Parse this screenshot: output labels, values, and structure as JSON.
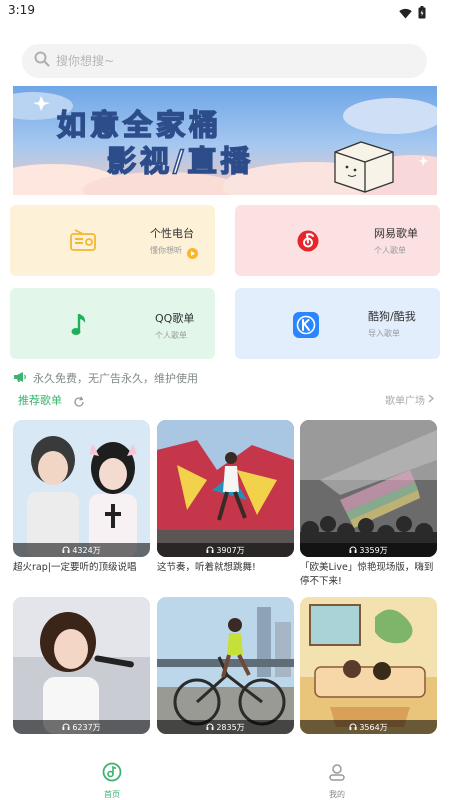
{
  "status_bar": {
    "time": "3:19"
  },
  "search": {
    "placeholder": "搜你想搜~"
  },
  "banner": {
    "line1": "如意全家桶",
    "line2": "影视/直播"
  },
  "cards": [
    {
      "title": "个性电台",
      "subtitle": "懂你想听",
      "accent": "#f5b731"
    },
    {
      "title": "网易歌单",
      "subtitle": "个人歌单",
      "accent": "#e5272d"
    },
    {
      "title": "QQ歌单",
      "subtitle": "个人歌单",
      "accent": "#1fb15a"
    },
    {
      "title": "酷狗/酷我",
      "subtitle": "导入歌单",
      "accent": "#2a86ff"
    }
  ],
  "notice": {
    "text": "永久免费，无广告永久，维护使用"
  },
  "section": {
    "title": "推荐歌单",
    "more": "歌单广场"
  },
  "playlists": [
    {
      "plays": "4324万",
      "caption": "超火rap|一定要听的顶级说唱"
    },
    {
      "plays": "3907万",
      "caption": "这节奏，听着就想跳舞!"
    },
    {
      "plays": "3359万",
      "caption": "「欧美Live」惊艳现场版，嗨到停不下来!"
    },
    {
      "plays": "6237万",
      "caption": ""
    },
    {
      "plays": "2835万",
      "caption": ""
    },
    {
      "plays": "3564万",
      "caption": ""
    }
  ],
  "tabs": [
    {
      "label": "首页",
      "active": true
    },
    {
      "label": "我的",
      "active": false
    }
  ],
  "colors": {
    "accent": "#3cb371",
    "banner_dot_active": "#3a6fe0"
  }
}
